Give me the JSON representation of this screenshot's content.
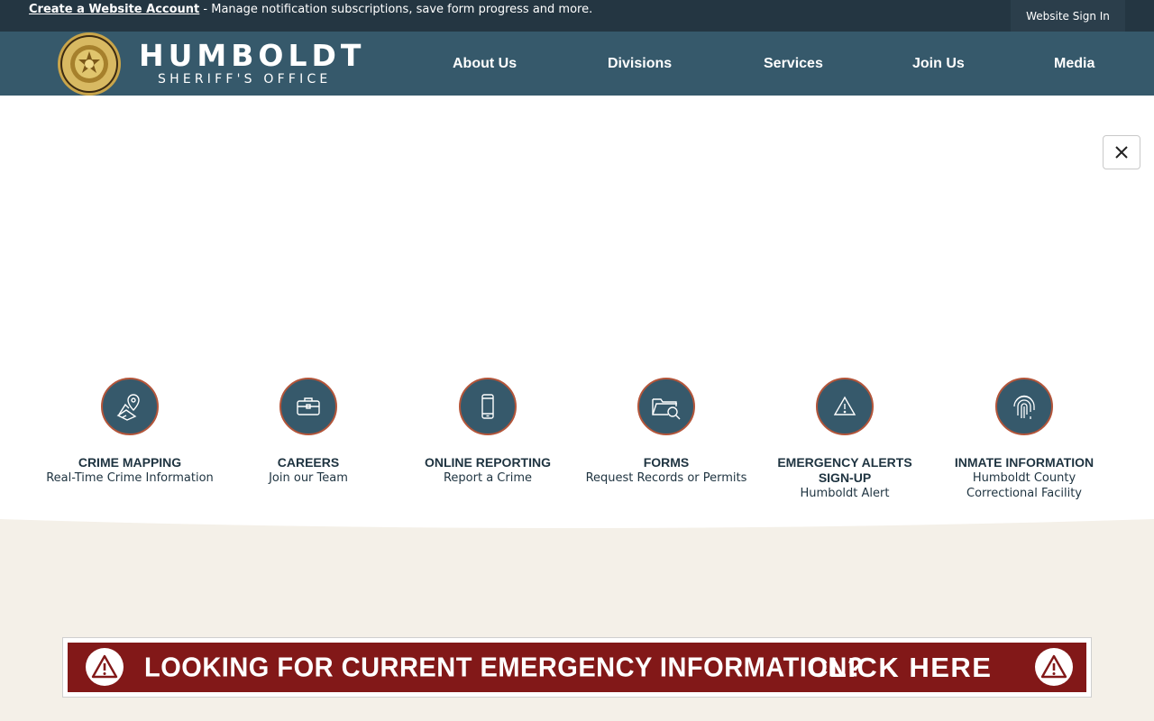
{
  "topbar": {
    "create_account_link": "Create a Website Account",
    "notice_text": " - Manage notification subscriptions, save form progress and more.",
    "signin_label": "Website Sign In"
  },
  "brand": {
    "title": "HUMBOLDT",
    "subtitle": "SHERIFF'S OFFICE",
    "seal_text": "HUMBOLDT COUNTY SHERIFF'S OFFICE · ESTABLISHED 1853"
  },
  "nav": {
    "items": [
      {
        "label": "About Us"
      },
      {
        "label": "Divisions"
      },
      {
        "label": "Services"
      },
      {
        "label": "Join Us"
      },
      {
        "label": "Media"
      }
    ]
  },
  "close_icon": "close-icon",
  "quick_links": [
    {
      "icon": "map-pin-icon",
      "title": "CRIME MAPPING",
      "subtitle": "Real-Time Crime Information"
    },
    {
      "icon": "briefcase-icon",
      "title": "CAREERS",
      "subtitle": "Join our Team"
    },
    {
      "icon": "mobile-phone-icon",
      "title": "ONLINE REPORTING",
      "subtitle": "Report a Crime"
    },
    {
      "icon": "folder-search-icon",
      "title": "FORMS",
      "subtitle": "Request Records or Permits"
    },
    {
      "icon": "warning-icon",
      "title": "EMERGENCY ALERTS SIGN-UP",
      "subtitle": "Humboldt Alert"
    },
    {
      "icon": "fingerprint-icon",
      "title": "INMATE INFORMATION",
      "subtitle": "Humboldt County Correctional Facility"
    }
  ],
  "emergency_banner": {
    "message": "LOOKING FOR CURRENT EMERGENCY INFORMATION?",
    "cta": "CLICK HERE"
  },
  "colors": {
    "topbar": "#243642",
    "header": "#36596b",
    "icon_circle": "#36596b",
    "icon_ring": "#b3553a",
    "banner": "#821818",
    "beige": "#f4f0e8"
  }
}
